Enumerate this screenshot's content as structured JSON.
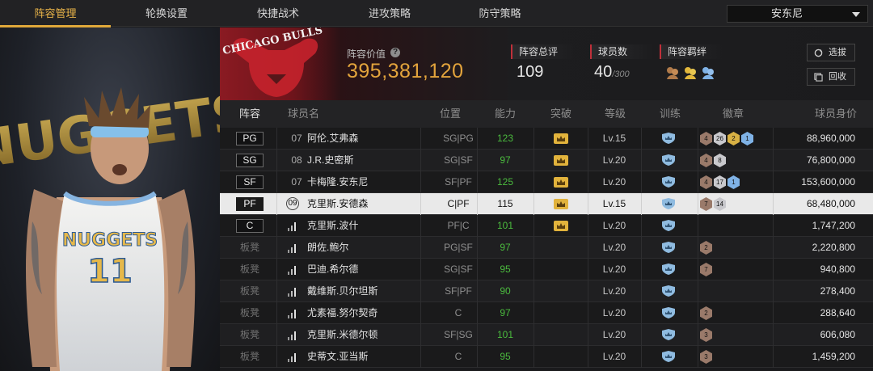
{
  "nav": {
    "tabs": [
      "阵容管理",
      "轮换设置",
      "快捷战术",
      "进攻策略",
      "防守策略"
    ],
    "active_tab": 0,
    "selector_value": "安东尼"
  },
  "header": {
    "lineup_value_label": "阵容价值",
    "lineup_value": "395,381,120",
    "overall_label": "阵容总评",
    "overall_value": "109",
    "player_count_label": "球员数",
    "player_count": "40",
    "player_count_max": "/300",
    "chemistry_label": "阵容羁绊",
    "select_button": "选拔",
    "recycle_button": "回收",
    "team_logo_text": "CHICAGO BULLS"
  },
  "columns": [
    "阵容",
    "球员名",
    "位置",
    "能力",
    "突破",
    "等级",
    "训练",
    "徽章",
    "球员身价"
  ],
  "players": [
    {
      "slot": "PG",
      "starter": true,
      "num": "07",
      "name": "阿伦.艾弗森",
      "position": "SG|PG",
      "ability": "123",
      "level": "Lv.15",
      "badges": [
        {
          "t": "bronze",
          "v": "4"
        },
        {
          "t": "silver",
          "v": "26"
        },
        {
          "t": "gold",
          "v": "2"
        },
        {
          "t": "blue",
          "v": "1"
        }
      ],
      "value": "88,960,000"
    },
    {
      "slot": "SG",
      "starter": true,
      "num": "08",
      "name": "J.R.史密斯",
      "position": "SG|SF",
      "ability": "97",
      "level": "Lv.20",
      "badges": [
        {
          "t": "bronze",
          "v": "4"
        },
        {
          "t": "silver",
          "v": "8"
        }
      ],
      "value": "76,800,000"
    },
    {
      "slot": "SF",
      "starter": true,
      "num": "07",
      "name": "卡梅隆.安东尼",
      "position": "SF|PF",
      "ability": "125",
      "level": "Lv.20",
      "badges": [
        {
          "t": "bronze",
          "v": "4"
        },
        {
          "t": "silver",
          "v": "17"
        },
        {
          "t": "blue",
          "v": "1"
        }
      ],
      "value": "153,600,000"
    },
    {
      "slot": "PF",
      "starter": true,
      "num": "09",
      "name": "克里斯.安德森",
      "position": "C|PF",
      "ability": "115",
      "level": "Lv.15",
      "badges": [
        {
          "t": "bronze",
          "v": "7"
        },
        {
          "t": "silver",
          "v": "14"
        }
      ],
      "value": "68,480,000",
      "selected": true
    },
    {
      "slot": "C",
      "starter": true,
      "num": "",
      "name": "克里斯.波什",
      "position": "PF|C",
      "ability": "101",
      "level": "Lv.20",
      "badges": [],
      "value": "1,747,200"
    },
    {
      "slot": "板凳",
      "starter": false,
      "num": "",
      "name": "朗佐.鲍尔",
      "position": "PG|SF",
      "ability": "97",
      "level": "Lv.20",
      "badges": [
        {
          "t": "bronze",
          "v": "2"
        }
      ],
      "value": "2,220,800"
    },
    {
      "slot": "板凳",
      "starter": false,
      "num": "",
      "name": "巴迪.希尔德",
      "position": "SG|SF",
      "ability": "95",
      "level": "Lv.20",
      "badges": [
        {
          "t": "bronze",
          "v": "7"
        }
      ],
      "value": "940,800"
    },
    {
      "slot": "板凳",
      "starter": false,
      "num": "",
      "name": "戴维斯.贝尔坦斯",
      "position": "SF|PF",
      "ability": "90",
      "level": "Lv.20",
      "badges": [],
      "value": "278,400"
    },
    {
      "slot": "板凳",
      "starter": false,
      "num": "",
      "name": "尤素福.努尔契奇",
      "position": "C",
      "ability": "97",
      "level": "Lv.20",
      "badges": [
        {
          "t": "bronze",
          "v": "2"
        }
      ],
      "value": "288,640"
    },
    {
      "slot": "板凳",
      "starter": false,
      "num": "",
      "name": "克里斯.米德尔顿",
      "position": "SF|SG",
      "ability": "101",
      "level": "Lv.20",
      "badges": [
        {
          "t": "bronze",
          "v": "3"
        }
      ],
      "value": "606,080"
    },
    {
      "slot": "板凳",
      "starter": false,
      "num": "",
      "name": "史蒂文.亚当斯",
      "position": "C",
      "ability": "95",
      "level": "Lv.20",
      "badges": [
        {
          "t": "bronze",
          "v": "3"
        }
      ],
      "value": "1,459,200"
    }
  ],
  "art": {
    "jersey_team": "NUGGETS",
    "jersey_number": "11",
    "backdrop_text": "NUGGETS"
  },
  "colors": {
    "accent": "#e0a83a",
    "green": "#4bbb3e",
    "bulls_red": "#8a1a22",
    "nuggets_blue": "#86b4e0"
  }
}
